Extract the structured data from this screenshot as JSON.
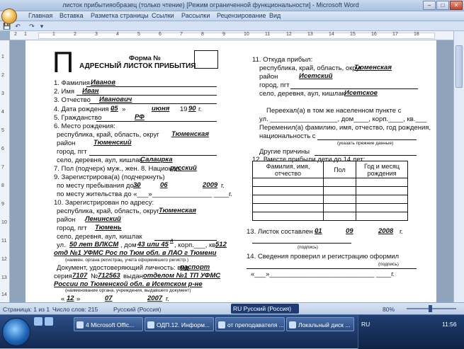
{
  "window": {
    "title": "листок прибытияобразец (только чтение) [Режим ограниченной функциональности] - Microsoft Word",
    "min": "–",
    "max": "□",
    "close": "✕"
  },
  "ribbon_tabs": [
    "Главная",
    "Вставка",
    "Разметка страницы",
    "Ссылки",
    "Рассылки",
    "Рецензирование",
    "Вид"
  ],
  "qat": {
    "save": "💾",
    "undo": "↶",
    "redo": "↷",
    "more": "▾"
  },
  "ruler_numbers": [
    "1",
    "2",
    "1",
    "2",
    "3",
    "4",
    "5",
    "6",
    "7",
    "8",
    "9",
    "10",
    "11",
    "12",
    "13",
    "14",
    "15",
    "16",
    "17",
    "18"
  ],
  "vruler_numbers": [
    "1",
    "2",
    "3",
    "4",
    "5",
    "6",
    "7",
    "8",
    "9",
    "10",
    "11",
    "12",
    "13",
    "14"
  ],
  "form": {
    "big_letter": "П",
    "form_no": "Форма №",
    "title": "АДРЕСНЫЙ ЛИСТОК ПРИБЫТИЯ",
    "f1": "1. Фамилия",
    "f1v": "Иванов",
    "f2": "2. Имя",
    "f2v": "Иван",
    "f3": "3. Отчество",
    "f3v": "Иванович",
    "f4": "4. Дата рождения «",
    "f4d": "05",
    "f4m": "июня",
    "f4y19": "19",
    "f4y": "90",
    "f4g": "г.",
    "f5": "5. Гражданство",
    "f5v": "РФ",
    "f6": "6. Место рождения:",
    "f6a": "республика, край, область, округ",
    "f6av": "Тюменская",
    "f6b": "район",
    "f6bv": "Тюменский",
    "f6c": "город, пгт",
    "f6d": "село, деревня, аул, кишлак",
    "f6dv": "Салаирка",
    "f7": "7. Пол (подчерк) муж., жен. 8. Национал.",
    "f7v": "русский",
    "f9": "9. Зарегистрирова(а) (подчеркнуть)",
    "f9a": "по месту пребывания до «",
    "f9ad": "30",
    "f9am": "06",
    "f9ay": "2009",
    "f9ag": "г.",
    "f9b": "по месту жительства до «___»________________ ____г.",
    "f10": "10. Зарегистрирован по адресу:",
    "f10a": "республика, край, область, округ",
    "f10av": "Тюменская",
    "f10b": "район",
    "f10bv": "Ленинский",
    "f10c": "город, пгт",
    "f10cv": "Тюмень",
    "f10d": "село, деревня, аул, кишлак",
    "f10e1": "ул.",
    "f10e2": "50 лет ВЛКСМ",
    "f10e3": ", дом",
    "f10e4": "43 или 45",
    "f10e4s": "А",
    "f10e5": ", корп.___, кв.",
    "f10e6": "512",
    "f10f": "отд №1 УФМС Рос по Тюм обл. в ЛАО г Тюмени",
    "f10fs": "(наимен. органа регистрац. учета оформившего регистр.)",
    "doc1": "Документ, удостоверяющий личность: вид",
    "doc1v": "паспорт",
    "doc2a": "серия",
    "doc2b": "7107",
    "doc2c": "№",
    "doc2d": "712563",
    "doc2e": "выдан",
    "doc2f": "отделом №1 ТП УФМС",
    "doc3": "России по Тюменской обл. в Исетском р-не",
    "doc3s": "(наименование органа, учреждения, выдавшего документ)",
    "docd1": "«",
    "docd2": "12",
    "docd3": "»",
    "docd4": "07",
    "docd5": "2007",
    "docd6": "г.",
    "r11": "11. Откуда прибыл:",
    "r11a": "республика, край, область, округ",
    "r11av": "Тюменская",
    "r11b": "район",
    "r11bv": "Исетский",
    "r11c": "город, пгт",
    "r11d": "село, деревня, аул, кишлак",
    "r11dv": "Исетское",
    "r11e": "Переехал(а) в том же населенном пункте с",
    "r11f": "ул. __________________, дом____, корп.____, кв.___",
    "r11g": "Переменил(а) фамилию, имя, отчество, год рождения,",
    "r11h": "национальность с",
    "r11hs": "(указать прежние данные)",
    "r11i": "Другие причины",
    "r12": "12. Вместе прибыли дети до 14 лет:",
    "t_h1": "Фамилия, имя, отчество",
    "t_h2": "Пол",
    "t_h3": "Год и месяц рождения",
    "r13": "13. Листок составлен «",
    "r13d": "01",
    "r13m": "09",
    "r13y": "2008",
    "r13g": "г.",
    "r13s": "(подпись)",
    "r14": "14. Сведения проверил и регистрацию оформил",
    "r14s": "(подпись)",
    "r14d": "«___»____________________________ ____г."
  },
  "status": {
    "page": "Страница: 1 из 1",
    "words": "Число слов: 215",
    "lang": "Русский (Россия)",
    "kbd": "RU Русский (Россия)",
    "zoom": "80%"
  },
  "taskbar": {
    "items": [
      "4 Microsoft Offic...",
      "ОДП.12. Информ...",
      "от преподавателя ...",
      "Локальный диск ..."
    ],
    "lang": "RU",
    "time": "11:56"
  }
}
